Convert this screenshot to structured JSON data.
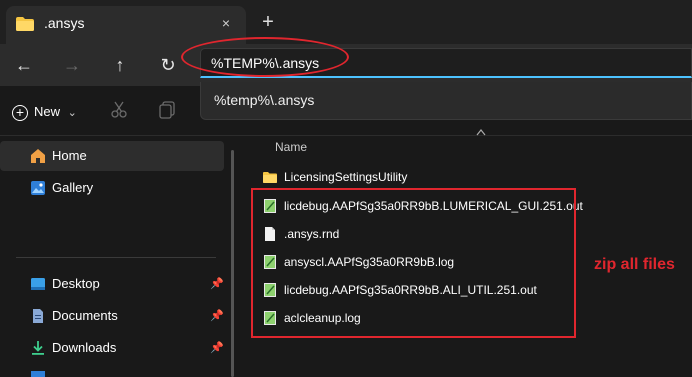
{
  "tab": {
    "title": ".ansys",
    "close_glyph": "×",
    "new_tab_glyph": "+"
  },
  "nav": {
    "back": "←",
    "forward": "→",
    "up": "↑",
    "refresh": "↻"
  },
  "address": {
    "value": "%TEMP%\\.ansys"
  },
  "dropdown": {
    "suggestion": "%temp%\\.ansys"
  },
  "command_bar": {
    "new_label": "New",
    "new_chevron": "⌄"
  },
  "sidebar": {
    "items": [
      {
        "label": "Home",
        "icon": "home-icon"
      },
      {
        "label": "Gallery",
        "icon": "gallery-icon"
      },
      {
        "label": "Desktop",
        "icon": "desktop-icon"
      },
      {
        "label": "Documents",
        "icon": "documents-icon"
      },
      {
        "label": "Downloads",
        "icon": "downloads-icon"
      }
    ]
  },
  "file_list": {
    "column_name": "Name",
    "rows": [
      {
        "name": "LicensingSettingsUtility",
        "type": "folder"
      },
      {
        "name": "licdebug.AAPfSg35a0RR9bB.LUMERICAL_GUI.251.out",
        "type": "notepad"
      },
      {
        "name": ".ansys.rnd",
        "type": "file"
      },
      {
        "name": "ansyscl.AAPfSg35a0RR9bB.log",
        "type": "notepad"
      },
      {
        "name": "licdebug.AAPfSg35a0RR9bB.ALI_UTIL.251.out",
        "type": "notepad"
      },
      {
        "name": "aclcleanup.log",
        "type": "notepad"
      }
    ]
  },
  "annotation": {
    "text": "zip all files",
    "color": "#e0262e"
  },
  "colors": {
    "accent": "#4cc2ff",
    "background": "#191919",
    "folder": "#f5c542"
  }
}
